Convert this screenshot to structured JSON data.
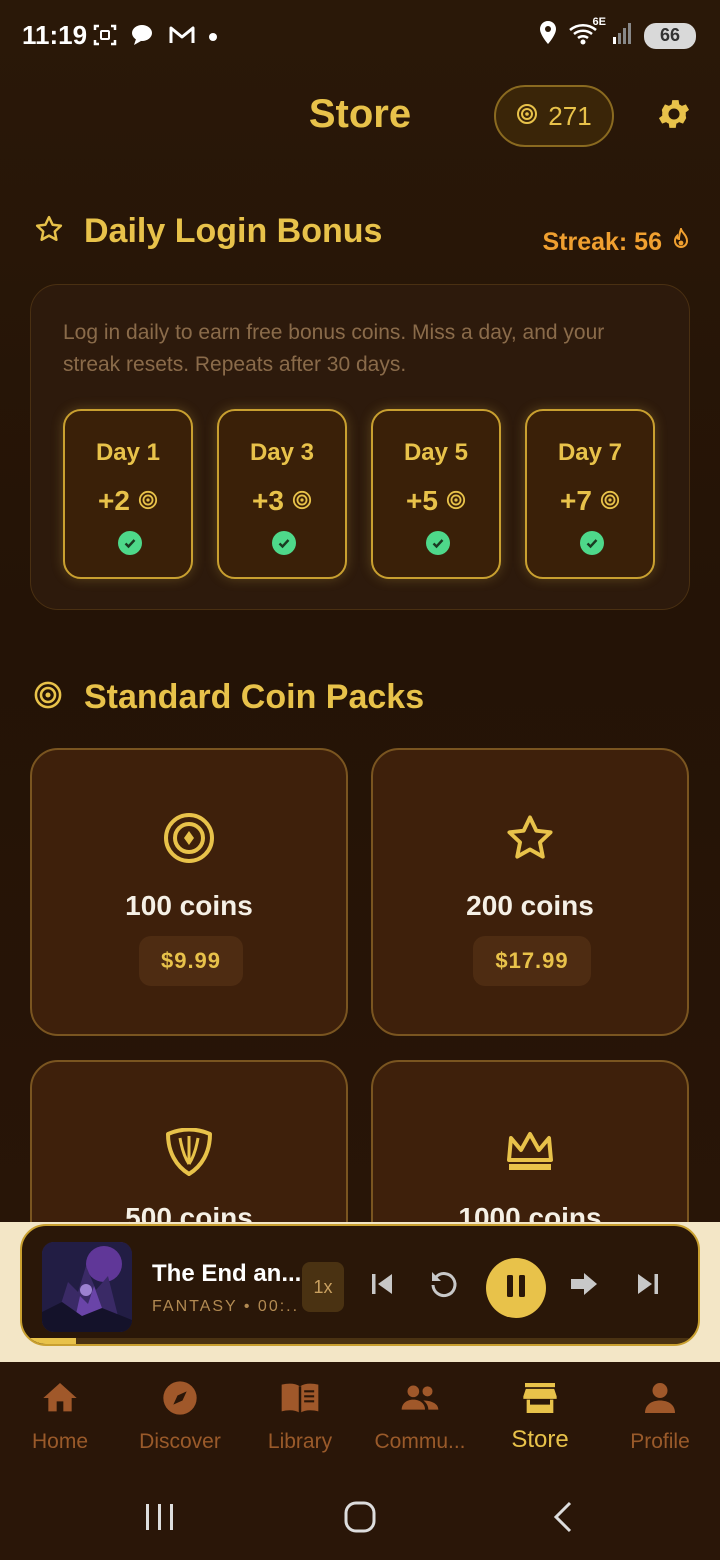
{
  "status_bar": {
    "time": "11:19",
    "network": "6E",
    "battery": "66"
  },
  "header": {
    "title": "Store",
    "coin_balance": "271"
  },
  "daily_bonus": {
    "title": "Daily Login Bonus",
    "streak_label": "Streak: 56",
    "description": "Log in daily to earn free bonus coins. Miss a day, and your streak resets. Repeats after 30 days.",
    "days": [
      {
        "label": "Day 1",
        "reward": "+2",
        "claimed": true
      },
      {
        "label": "Day 3",
        "reward": "+3",
        "claimed": true
      },
      {
        "label": "Day 5",
        "reward": "+5",
        "claimed": true
      },
      {
        "label": "Day 7",
        "reward": "+7",
        "claimed": true
      }
    ]
  },
  "coin_packs": {
    "title": "Standard Coin Packs",
    "packs": [
      {
        "name": "100 coins",
        "price": "$9.99",
        "icon": "coin-target-icon"
      },
      {
        "name": "200 coins",
        "price": "$17.99",
        "icon": "star-icon"
      },
      {
        "name": "500 coins",
        "price": "",
        "icon": "shield-icon"
      },
      {
        "name": "1000 coins",
        "price": "",
        "icon": "crown-icon"
      }
    ]
  },
  "player": {
    "track_title": "The End an...",
    "track_meta": "FANTASY • 00:...",
    "speed": "1x",
    "progress_fraction": 0.08
  },
  "bottom_nav": {
    "items": [
      {
        "label": "Home",
        "icon": "home-icon",
        "active": false
      },
      {
        "label": "Discover",
        "icon": "compass-icon",
        "active": false
      },
      {
        "label": "Library",
        "icon": "book-icon",
        "active": false
      },
      {
        "label": "Commu...",
        "icon": "people-icon",
        "active": false
      },
      {
        "label": "Store",
        "icon": "store-icon",
        "active": true
      },
      {
        "label": "Profile",
        "icon": "person-icon",
        "active": false
      }
    ]
  },
  "colors": {
    "accent": "#e8c24a",
    "background": "#241306",
    "streak": "#f0a030",
    "check": "#4ed88a"
  }
}
